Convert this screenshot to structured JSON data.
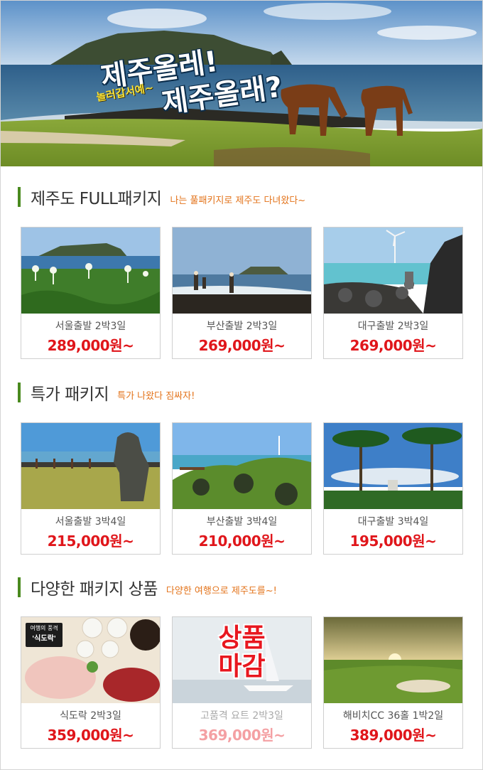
{
  "hero": {
    "title_line1": "제주올레!",
    "title_line2": "제주올래?",
    "subtitle": "놀러갑서예~"
  },
  "sections": [
    {
      "title": "제주도 FULL패키지",
      "subtitle": "나는 풀패키지로 제주도 다녀왔다~",
      "cards": [
        {
          "label": "서울출발 2박3일",
          "price": "289,000원~",
          "scene": "seongsan-flowers"
        },
        {
          "label": "부산출발 2박3일",
          "price": "269,000원~",
          "scene": "beach-people"
        },
        {
          "label": "대구출발 2박3일",
          "price": "269,000원~",
          "scene": "windmill-rocks"
        }
      ]
    },
    {
      "title": "특가 패키지",
      "subtitle": "특가 나왔다 짐싸자!",
      "cards": [
        {
          "label": "서울출발 3박4일",
          "price": "215,000원~",
          "scene": "dolharubang-coast"
        },
        {
          "label": "부산출발 3박4일",
          "price": "210,000원~",
          "scene": "green-coast-windmill"
        },
        {
          "label": "대구출발 3박4일",
          "price": "195,000원~",
          "scene": "palm-garden"
        }
      ]
    },
    {
      "title": "다양한 패키지 상품",
      "subtitle": "다양한 여행으로 제주도를~!",
      "cards": [
        {
          "label": "식도락 2박3일",
          "price": "359,000원~",
          "scene": "food-table",
          "badge_top": "여행의 풍격",
          "badge_main": "'식도락'"
        },
        {
          "label": "고품격 요트 2박3일",
          "price": "369,000원~",
          "scene": "yacht",
          "closed": "상품\n마감"
        },
        {
          "label": "해비치CC 36홀 1박2일",
          "price": "389,000원~",
          "scene": "golf"
        }
      ]
    }
  ]
}
